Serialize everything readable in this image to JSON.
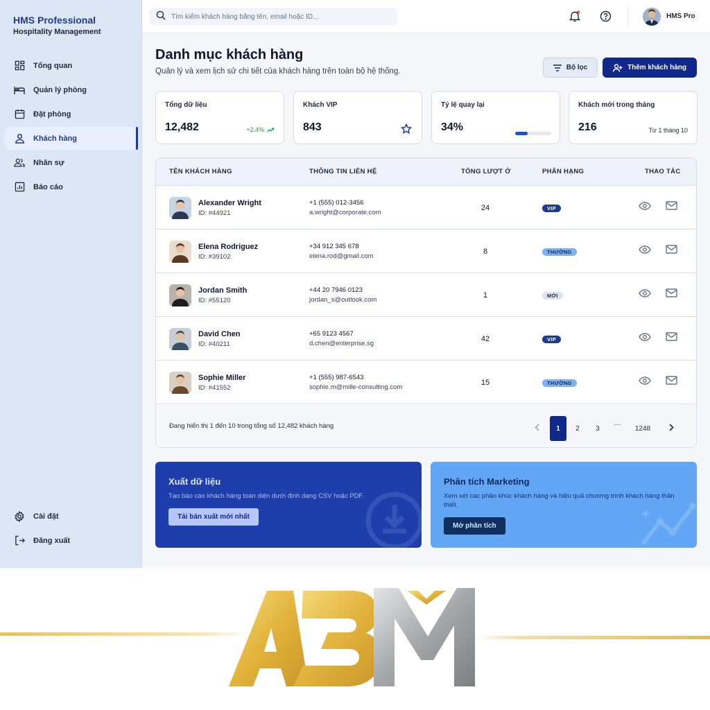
{
  "brand": {
    "name": "HMS Professional",
    "subtitle": "Hospitality Management"
  },
  "sidebar": {
    "items": [
      {
        "label": "Tổng quan",
        "icon": "dashboard-icon"
      },
      {
        "label": "Quản lý phòng",
        "icon": "bed-icon"
      },
      {
        "label": "Đặt phòng",
        "icon": "calendar-icon"
      },
      {
        "label": "Khách hàng",
        "icon": "person-icon",
        "active": true
      },
      {
        "label": "Nhân sự",
        "icon": "group-icon"
      },
      {
        "label": "Báo cáo",
        "icon": "report-icon"
      }
    ],
    "bottom": [
      {
        "label": "Cài đặt",
        "icon": "gear-icon"
      },
      {
        "label": "Đăng xuất",
        "icon": "logout-icon"
      }
    ]
  },
  "topbar": {
    "search_placeholder": "Tìm kiếm khách hàng bằng tên, email hoặc ID...",
    "user_name": "HMS Pro"
  },
  "header": {
    "title": "Danh mục khách hàng",
    "subtitle": "Quản lý và xem lịch sử chi tiết của khách hàng trên toàn bộ hệ thống.",
    "filter_label": "Bộ lọc",
    "add_label": "Thêm khách hàng"
  },
  "stats": {
    "total": {
      "label": "Tổng dữ liệu",
      "value": "12,482",
      "trend": "+2.4%"
    },
    "vip": {
      "label": "Khách VIP",
      "value": "843"
    },
    "return_rate": {
      "label": "Tỷ lệ quay lại",
      "value": "34%",
      "progress": 0.34
    },
    "new_month": {
      "label": "Khách mới trong tháng",
      "value": "216",
      "note": "Từ 1 tháng 10"
    }
  },
  "table": {
    "headers": {
      "name": "TÊN KHÁCH HÀNG",
      "contact": "THÔNG TIN LIÊN HỆ",
      "stays": "TỔNG LƯỢT Ở",
      "tier": "PHÂN HẠNG",
      "actions": "THAO TÁC"
    },
    "rows": [
      {
        "name": "Alexander Wright",
        "id": "ID: #44921",
        "phone": "+1 (555) 012-3456",
        "email": "a.wright@corporate.com",
        "stays": "24",
        "tier": "VIP",
        "tier_type": "vip"
      },
      {
        "name": "Elena Rodriguez",
        "id": "ID: #39102",
        "phone": "+34 912 345 678",
        "email": "elena.rod@gmail.com",
        "stays": "8",
        "tier": "THƯỜNG",
        "tier_type": "normal"
      },
      {
        "name": "Jordan Smith",
        "id": "ID: #55120",
        "phone": "+44 20 7946 0123",
        "email": "jordan_s@outlook.com",
        "stays": "1",
        "tier": "MỚI",
        "tier_type": "new"
      },
      {
        "name": "David Chen",
        "id": "ID: #40211",
        "phone": "+65 9123 4567",
        "email": "d.chen@enterprise.sg",
        "stays": "42",
        "tier": "VIP",
        "tier_type": "vip"
      },
      {
        "name": "Sophie Miller",
        "id": "ID: #41552",
        "phone": "+1 (555) 987-6543",
        "email": "sophie.m@mille-consulting.com",
        "stays": "15",
        "tier": "THƯỜNG",
        "tier_type": "normal"
      }
    ],
    "footer_text": "Đang hiển thị 1 đến 10 trong tổng số 12,482 khách hàng",
    "pages": [
      "1",
      "2",
      "3",
      "···",
      "1248"
    ]
  },
  "promos": {
    "export": {
      "title": "Xuất dữ liệu",
      "desc": "Tạo báo cáo khách hàng toàn diện dưới định dạng CSV hoặc PDF.",
      "button": "Tải bản xuất mới nhất"
    },
    "marketing": {
      "title": "Phân tích Marketing",
      "desc": "Xem xét các phân khúc khách hàng và hiệu quả chương trình khách hàng thân thiết.",
      "button": "Mở phân tích"
    }
  },
  "logo": {
    "text": "ABM"
  },
  "colors": {
    "primary": "#10288a",
    "sidebar_bg": "#dde6f5",
    "gold": "#e8c35a",
    "silver": "#a7a9ac"
  }
}
